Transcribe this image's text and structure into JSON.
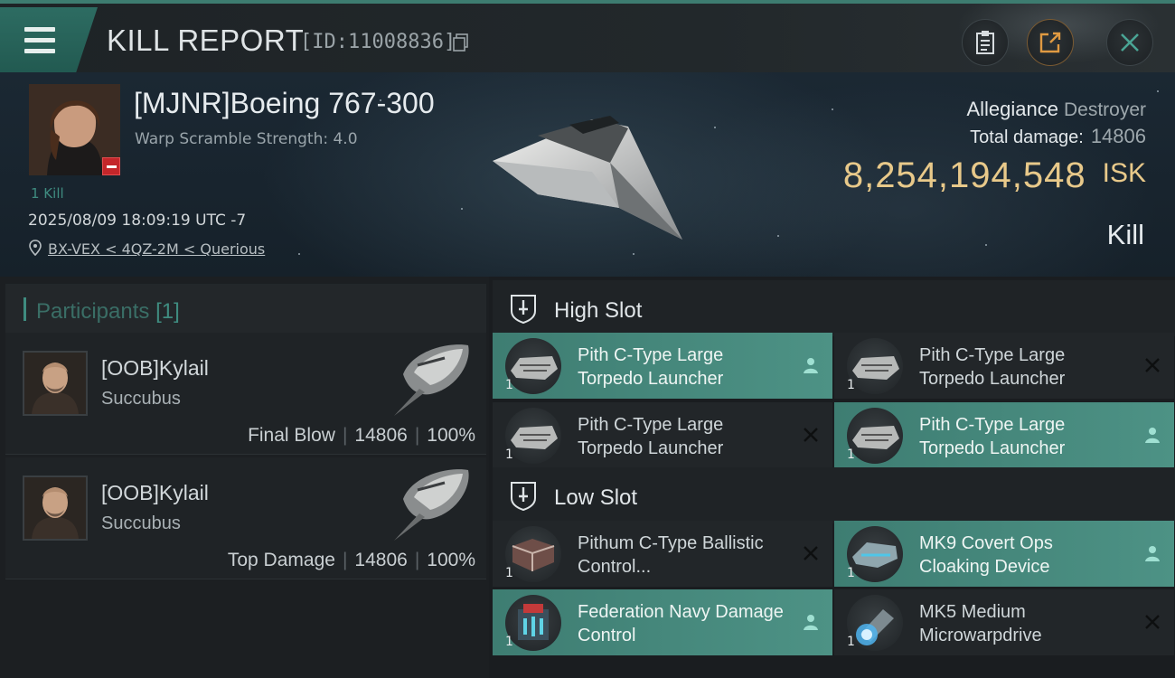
{
  "header": {
    "title": "KILL REPORT",
    "report_id": "[ID:11008836]"
  },
  "victim": {
    "name": "[MJNR]Boeing 767-300",
    "warp_scramble": "Warp Scramble Strength: 4.0",
    "kills": "1 Kill",
    "timestamp": "2025/08/09 18:09:19 UTC -7",
    "location": "BX-VEX < 4QZ-2M < Querious",
    "allegiance_label": "Allegiance",
    "allegiance_value": "Destroyer",
    "total_damage_label": "Total damage:",
    "total_damage_value": "14806",
    "isk_value": "8,254,194,548",
    "isk_unit": "ISK",
    "result": "Kill"
  },
  "participants": {
    "label": "Participants",
    "count": "[1]",
    "rows": [
      {
        "name": "[OOB]Kylail",
        "ship": "Succubus",
        "role": "Final Blow",
        "damage": "14806",
        "percent": "100%"
      },
      {
        "name": "[OOB]Kylail",
        "ship": "Succubus",
        "role": "Top Damage",
        "damage": "14806",
        "percent": "100%"
      }
    ]
  },
  "slots": {
    "high": {
      "label": "High Slot",
      "modules": [
        {
          "name": "Pith C-Type Large Torpedo Launcher",
          "qty": "1",
          "state": "dropped"
        },
        {
          "name": "Pith C-Type Large Torpedo Launcher",
          "qty": "1",
          "state": "destroyed"
        },
        {
          "name": "Pith C-Type Large Torpedo Launcher",
          "qty": "1",
          "state": "destroyed"
        },
        {
          "name": "Pith C-Type Large Torpedo Launcher",
          "qty": "1",
          "state": "dropped"
        }
      ]
    },
    "low": {
      "label": "Low Slot",
      "modules": [
        {
          "name": "Pithum C-Type Ballistic Control...",
          "qty": "1",
          "state": "destroyed"
        },
        {
          "name": "MK9 Covert Ops Cloaking Device",
          "qty": "1",
          "state": "dropped"
        },
        {
          "name": "Federation Navy Damage Control",
          "qty": "1",
          "state": "dropped"
        },
        {
          "name": "MK5 Medium Microwarpdrive",
          "qty": "1",
          "state": "destroyed"
        }
      ]
    }
  },
  "colors": {
    "accent": "#3f8c80",
    "isk": "#e8c98a",
    "highlight": "#4d9285",
    "badge": "#c4262a"
  }
}
